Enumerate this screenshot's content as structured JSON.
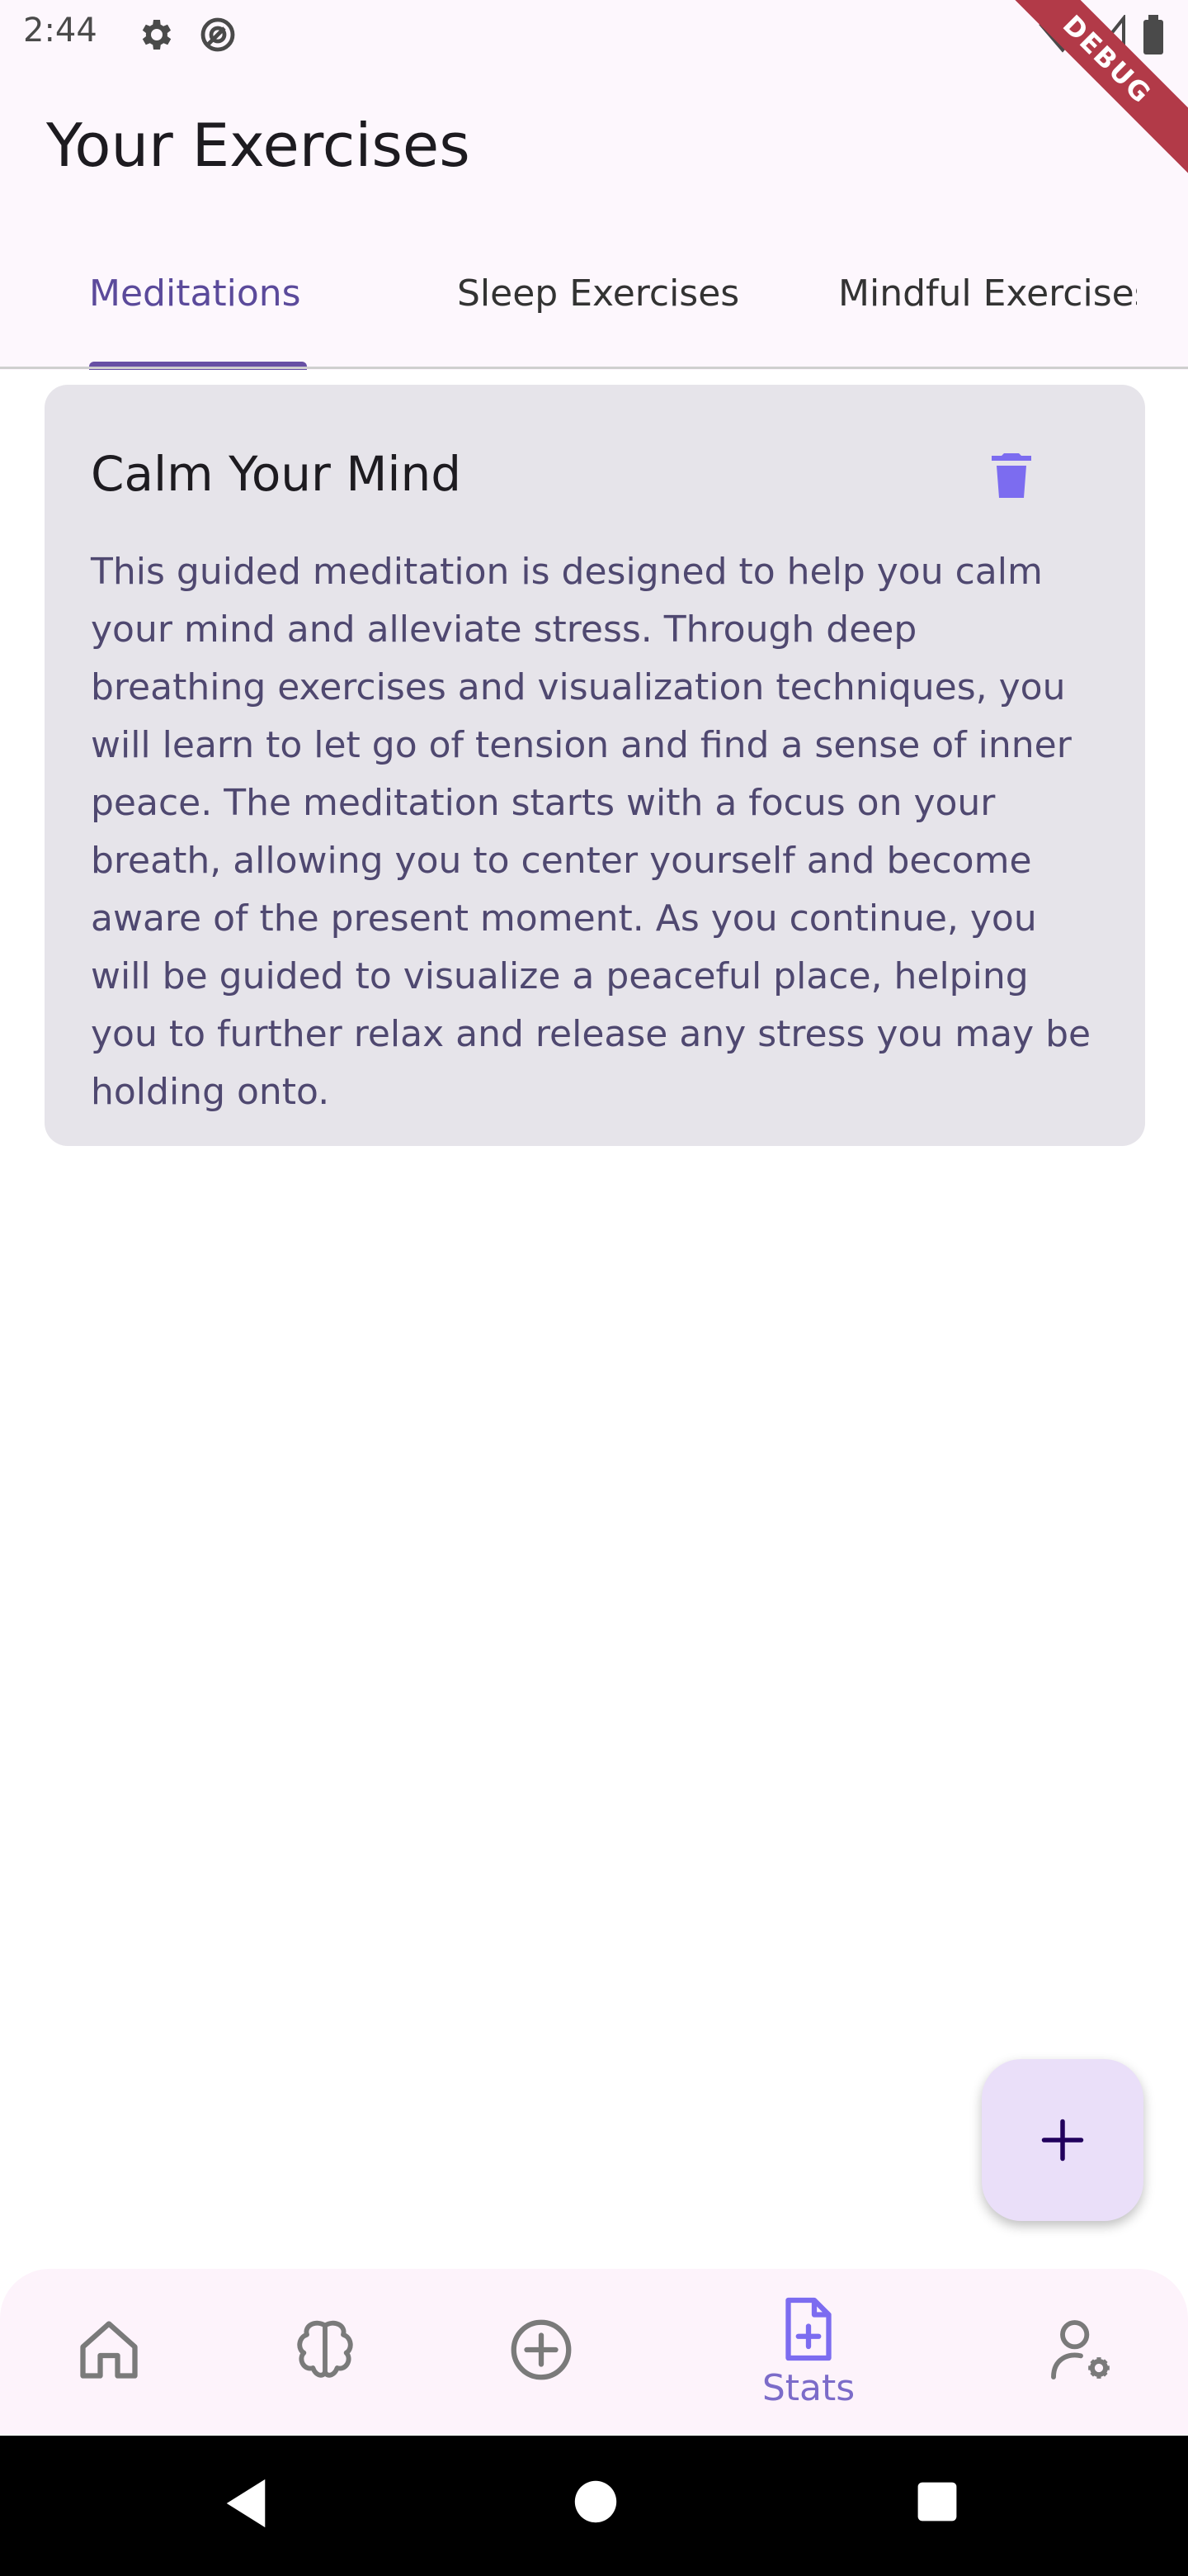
{
  "status_bar": {
    "time": "2:44",
    "debug_label": "DEBUG"
  },
  "header": {
    "title": "Your Exercises"
  },
  "tabs": [
    {
      "label": "Meditations",
      "active": true
    },
    {
      "label": "Sleep Exercises",
      "active": false
    },
    {
      "label": "Mindful Exercises",
      "active": false
    }
  ],
  "card": {
    "title": "Calm Your Mind",
    "description": "This guided meditation is designed to help you calm your mind and alleviate stress. Through deep breathing exercises and visualization techniques, you will learn to let go of tension and find a sense of inner peace. The meditation starts with a focus on your breath, allowing you to center yourself and become aware of the present moment. As you continue, you will be guided to visualize a peaceful place, helping you to further relax and release any stress you may be holding onto.",
    "delete_icon": "trash-icon"
  },
  "fab": {
    "icon": "plus-icon"
  },
  "bottom_nav": {
    "items": [
      {
        "icon": "home-icon",
        "label": ""
      },
      {
        "icon": "brain-icon",
        "label": ""
      },
      {
        "icon": "add-circle-icon",
        "label": ""
      },
      {
        "icon": "note-add-icon",
        "label": "Stats",
        "active": true
      },
      {
        "icon": "user-settings-icon",
        "label": ""
      }
    ]
  },
  "colors": {
    "accent": "#6750a4",
    "active_tab": "#5b4a9b",
    "card_bg": "#e6e4ea",
    "icon_accent": "#7c6cf0"
  }
}
